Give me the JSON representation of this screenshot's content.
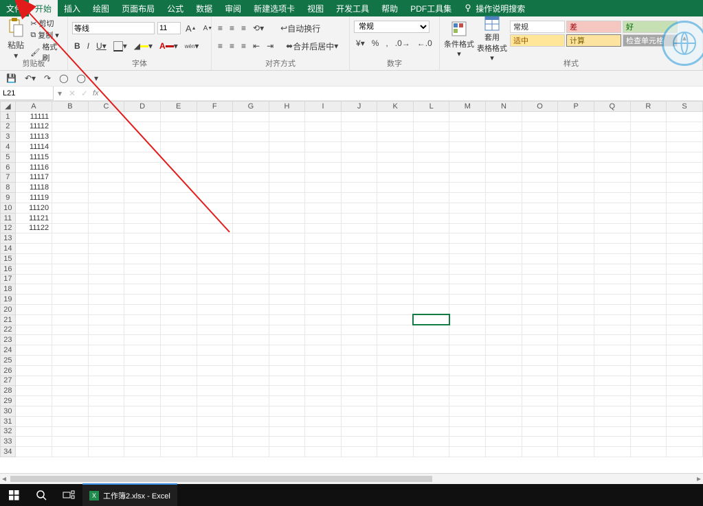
{
  "menu": {
    "tabs": [
      "文件",
      "开始",
      "插入",
      "绘图",
      "页面布局",
      "公式",
      "数据",
      "审阅",
      "新建选项卡",
      "视图",
      "开发工具",
      "帮助",
      "PDF工具集"
    ],
    "activeIndex": 1,
    "tellMe": "操作说明搜索"
  },
  "ribbon": {
    "clipboard": {
      "paste": "粘贴",
      "cut": "剪切",
      "copy": "复制",
      "formatPainter": "格式刷",
      "group": "剪贴板"
    },
    "font": {
      "family": "等线",
      "size": "11",
      "group": "字体",
      "bold": "B",
      "italic": "I",
      "underline": "U"
    },
    "align": {
      "wrap": "自动换行",
      "merge": "合并后居中",
      "group": "对齐方式"
    },
    "number": {
      "format": "常规",
      "group": "数字"
    },
    "styles": {
      "condfmt": "条件格式",
      "tablefmt": "套用\n表格格式",
      "cells": {
        "normal": "常规",
        "bad": "差",
        "good": "好",
        "neutral": "适中",
        "calc": "计算",
        "check": "检查单元格"
      },
      "group": "样式"
    },
    "insert": {
      "label": "插入"
    }
  },
  "namebox": {
    "ref": "L21",
    "fx": "fx"
  },
  "grid": {
    "columns": [
      "A",
      "B",
      "C",
      "D",
      "E",
      "F",
      "G",
      "H",
      "I",
      "J",
      "K",
      "L",
      "M",
      "N",
      "O",
      "P",
      "Q",
      "R",
      "S"
    ],
    "rowCount": 34,
    "selected": {
      "row": 21,
      "col": "L"
    },
    "dataA": [
      "11111",
      "11112",
      "11113",
      "11114",
      "11115",
      "11116",
      "11117",
      "11118",
      "11119",
      "11120",
      "11121",
      "11122"
    ]
  },
  "taskbar": {
    "file": "工作簿2.xlsx - Excel"
  }
}
